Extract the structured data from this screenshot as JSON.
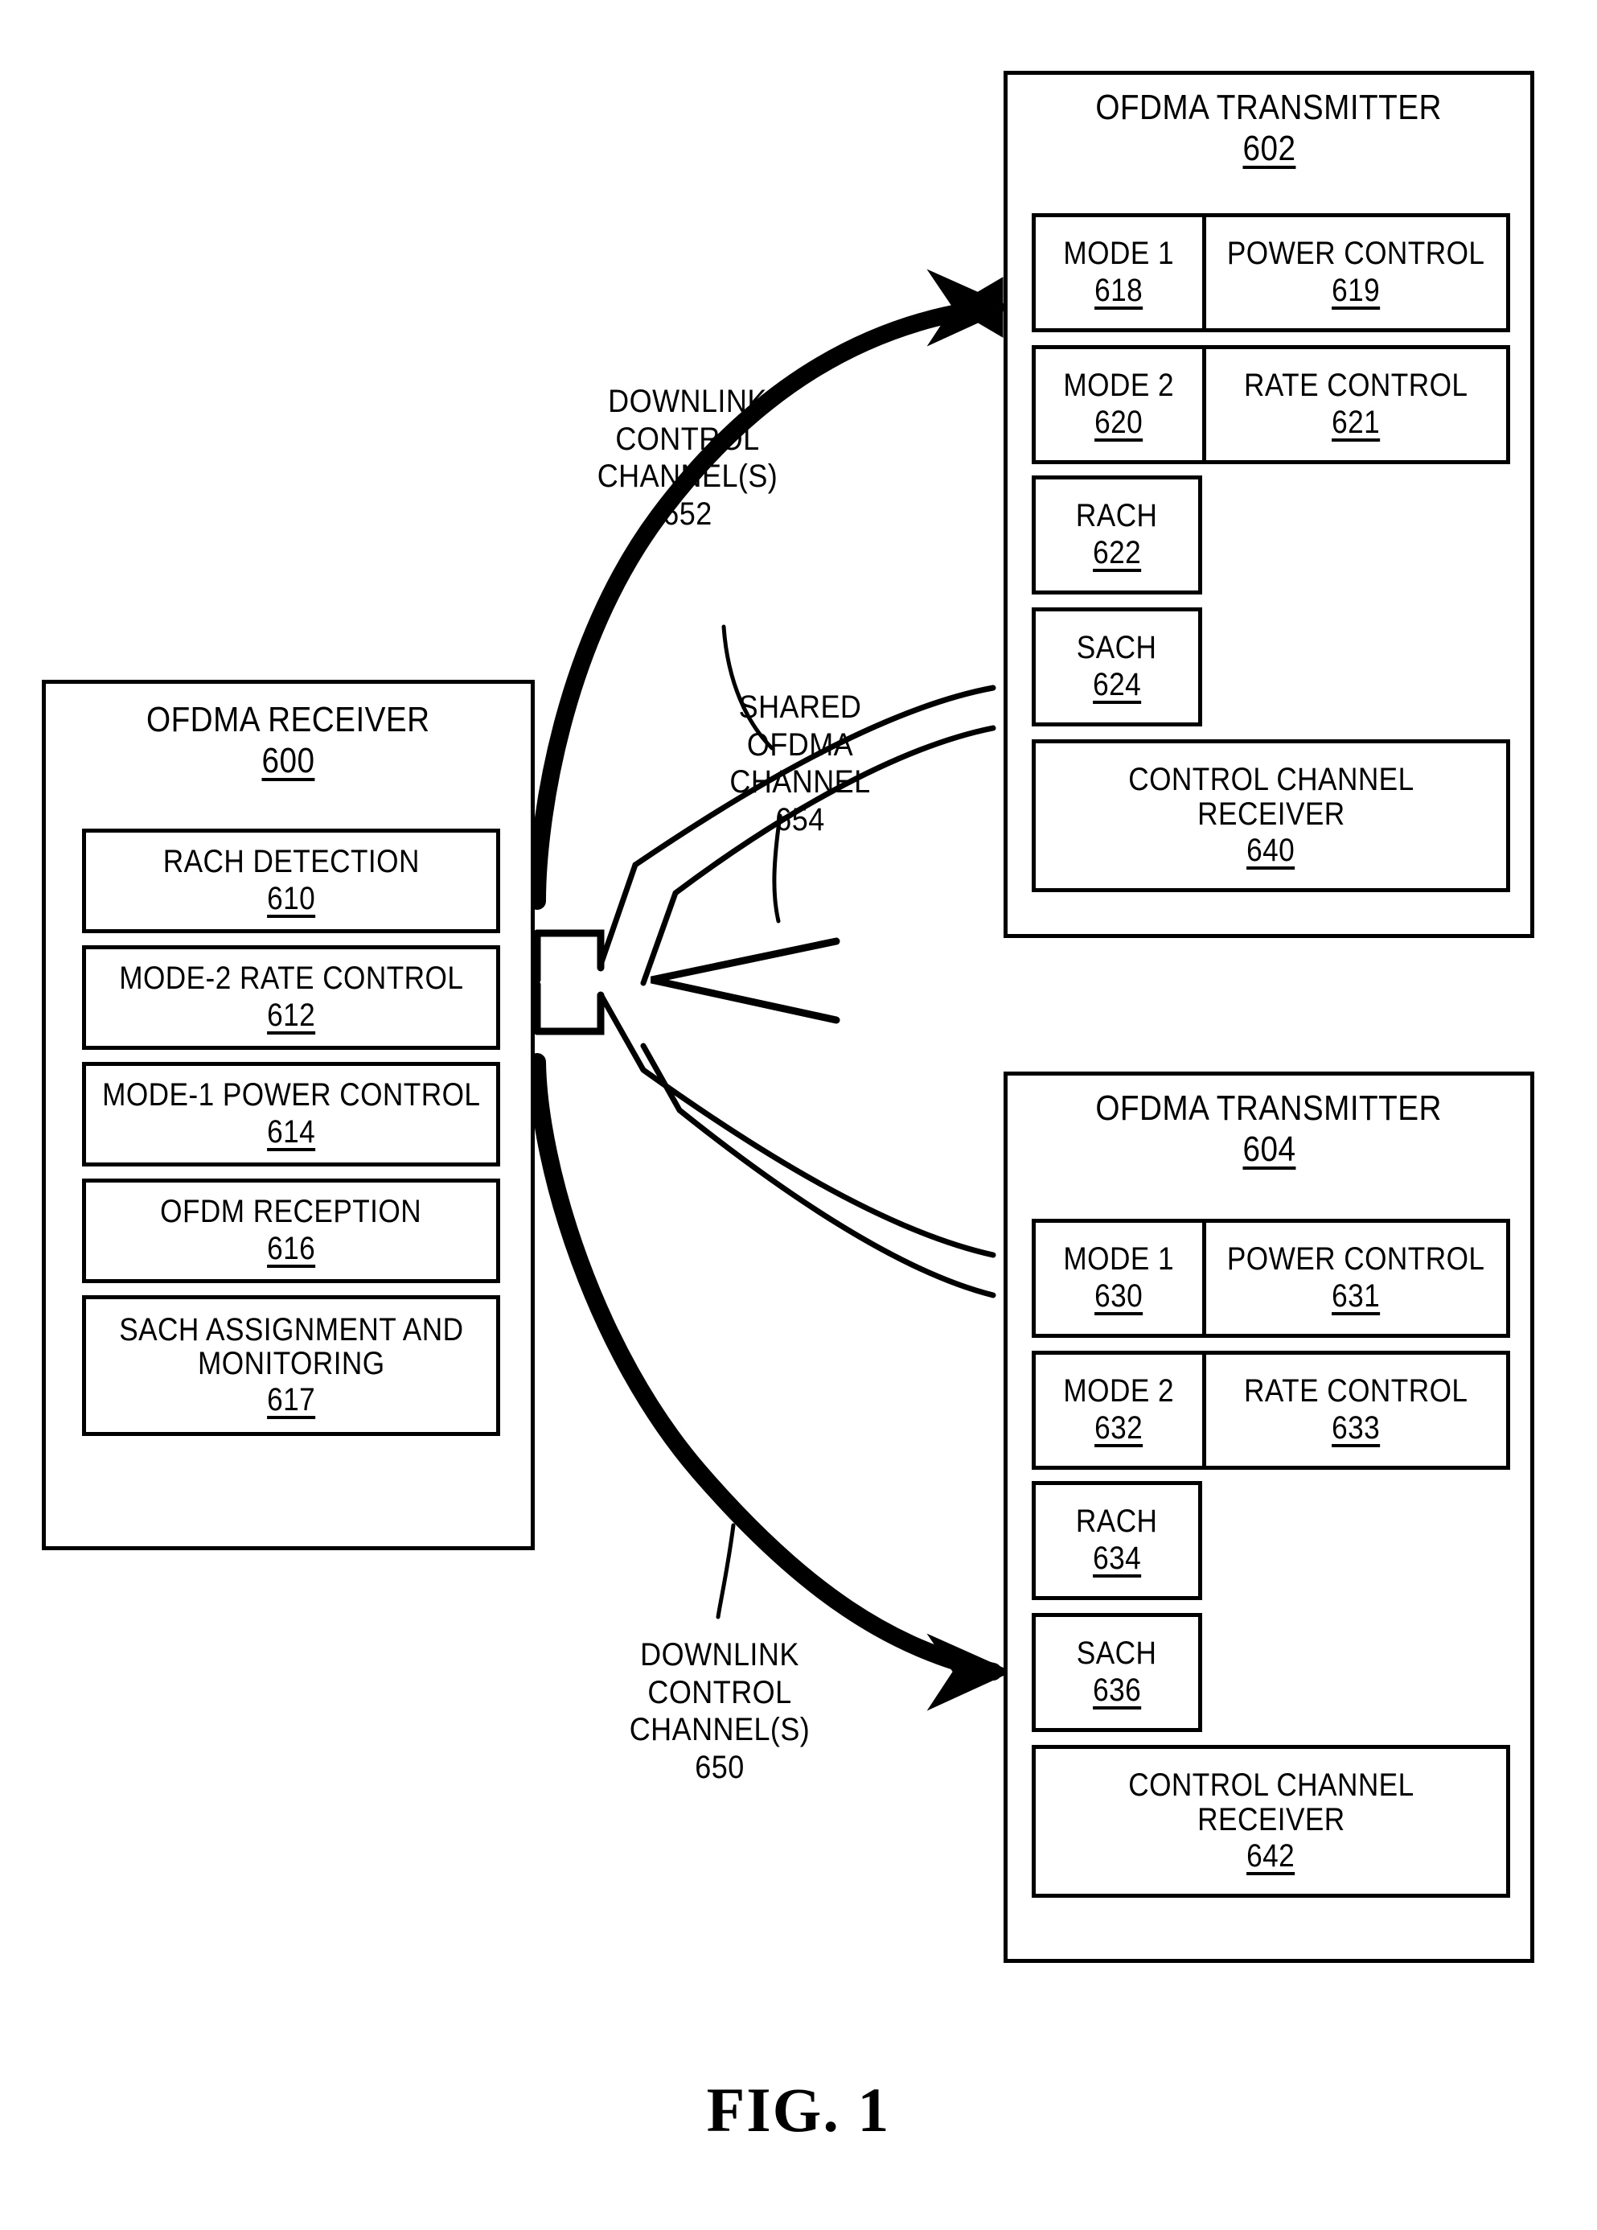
{
  "figure": {
    "caption": "FIG. 1"
  },
  "receiver": {
    "title": "OFDMA RECEIVER",
    "ref": "600",
    "modules": [
      {
        "label": "RACH DETECTION",
        "ref": "610"
      },
      {
        "label": "MODE-2 RATE CONTROL",
        "ref": "612"
      },
      {
        "label": "MODE-1 POWER CONTROL",
        "ref": "614"
      },
      {
        "label": "OFDM RECEPTION",
        "ref": "616"
      },
      {
        "label": "SACH ASSIGNMENT AND\nMONITORING",
        "ref": "617"
      }
    ]
  },
  "transmitter_top": {
    "title": "OFDMA TRANSMITTER",
    "ref": "602",
    "rows": [
      {
        "left_label": "MODE 1",
        "left_ref": "618",
        "right_label": "POWER CONTROL",
        "right_ref": "619"
      },
      {
        "left_label": "MODE 2",
        "left_ref": "620",
        "right_label": "RATE CONTROL",
        "right_ref": "621"
      }
    ],
    "small": [
      {
        "label": "RACH",
        "ref": "622"
      },
      {
        "label": "SACH",
        "ref": "624"
      }
    ],
    "wide": {
      "label": "CONTROL CHANNEL\nRECEIVER",
      "ref": "640"
    }
  },
  "transmitter_bottom": {
    "title": "OFDMA TRANSMITTER",
    "ref": "604",
    "rows": [
      {
        "left_label": "MODE 1",
        "left_ref": "630",
        "right_label": "POWER CONTROL",
        "right_ref": "631"
      },
      {
        "left_label": "MODE 2",
        "left_ref": "632",
        "right_label": "RATE CONTROL",
        "right_ref": "633"
      }
    ],
    "small": [
      {
        "label": "RACH",
        "ref": "634"
      },
      {
        "label": "SACH",
        "ref": "636"
      }
    ],
    "wide": {
      "label": "CONTROL CHANNEL\nRECEIVER",
      "ref": "642"
    }
  },
  "annotations": {
    "downlink_top": "DOWNLINK\nCONTROL\nCHANNEL(S)\n652",
    "shared_channel": "SHARED\nOFDMA\nCHANNEL\n654",
    "downlink_bottom": "DOWNLINK\nCONTROL\nCHANNEL(S)\n650"
  },
  "colors": {
    "ink": "#000000",
    "paper": "#ffffff"
  }
}
